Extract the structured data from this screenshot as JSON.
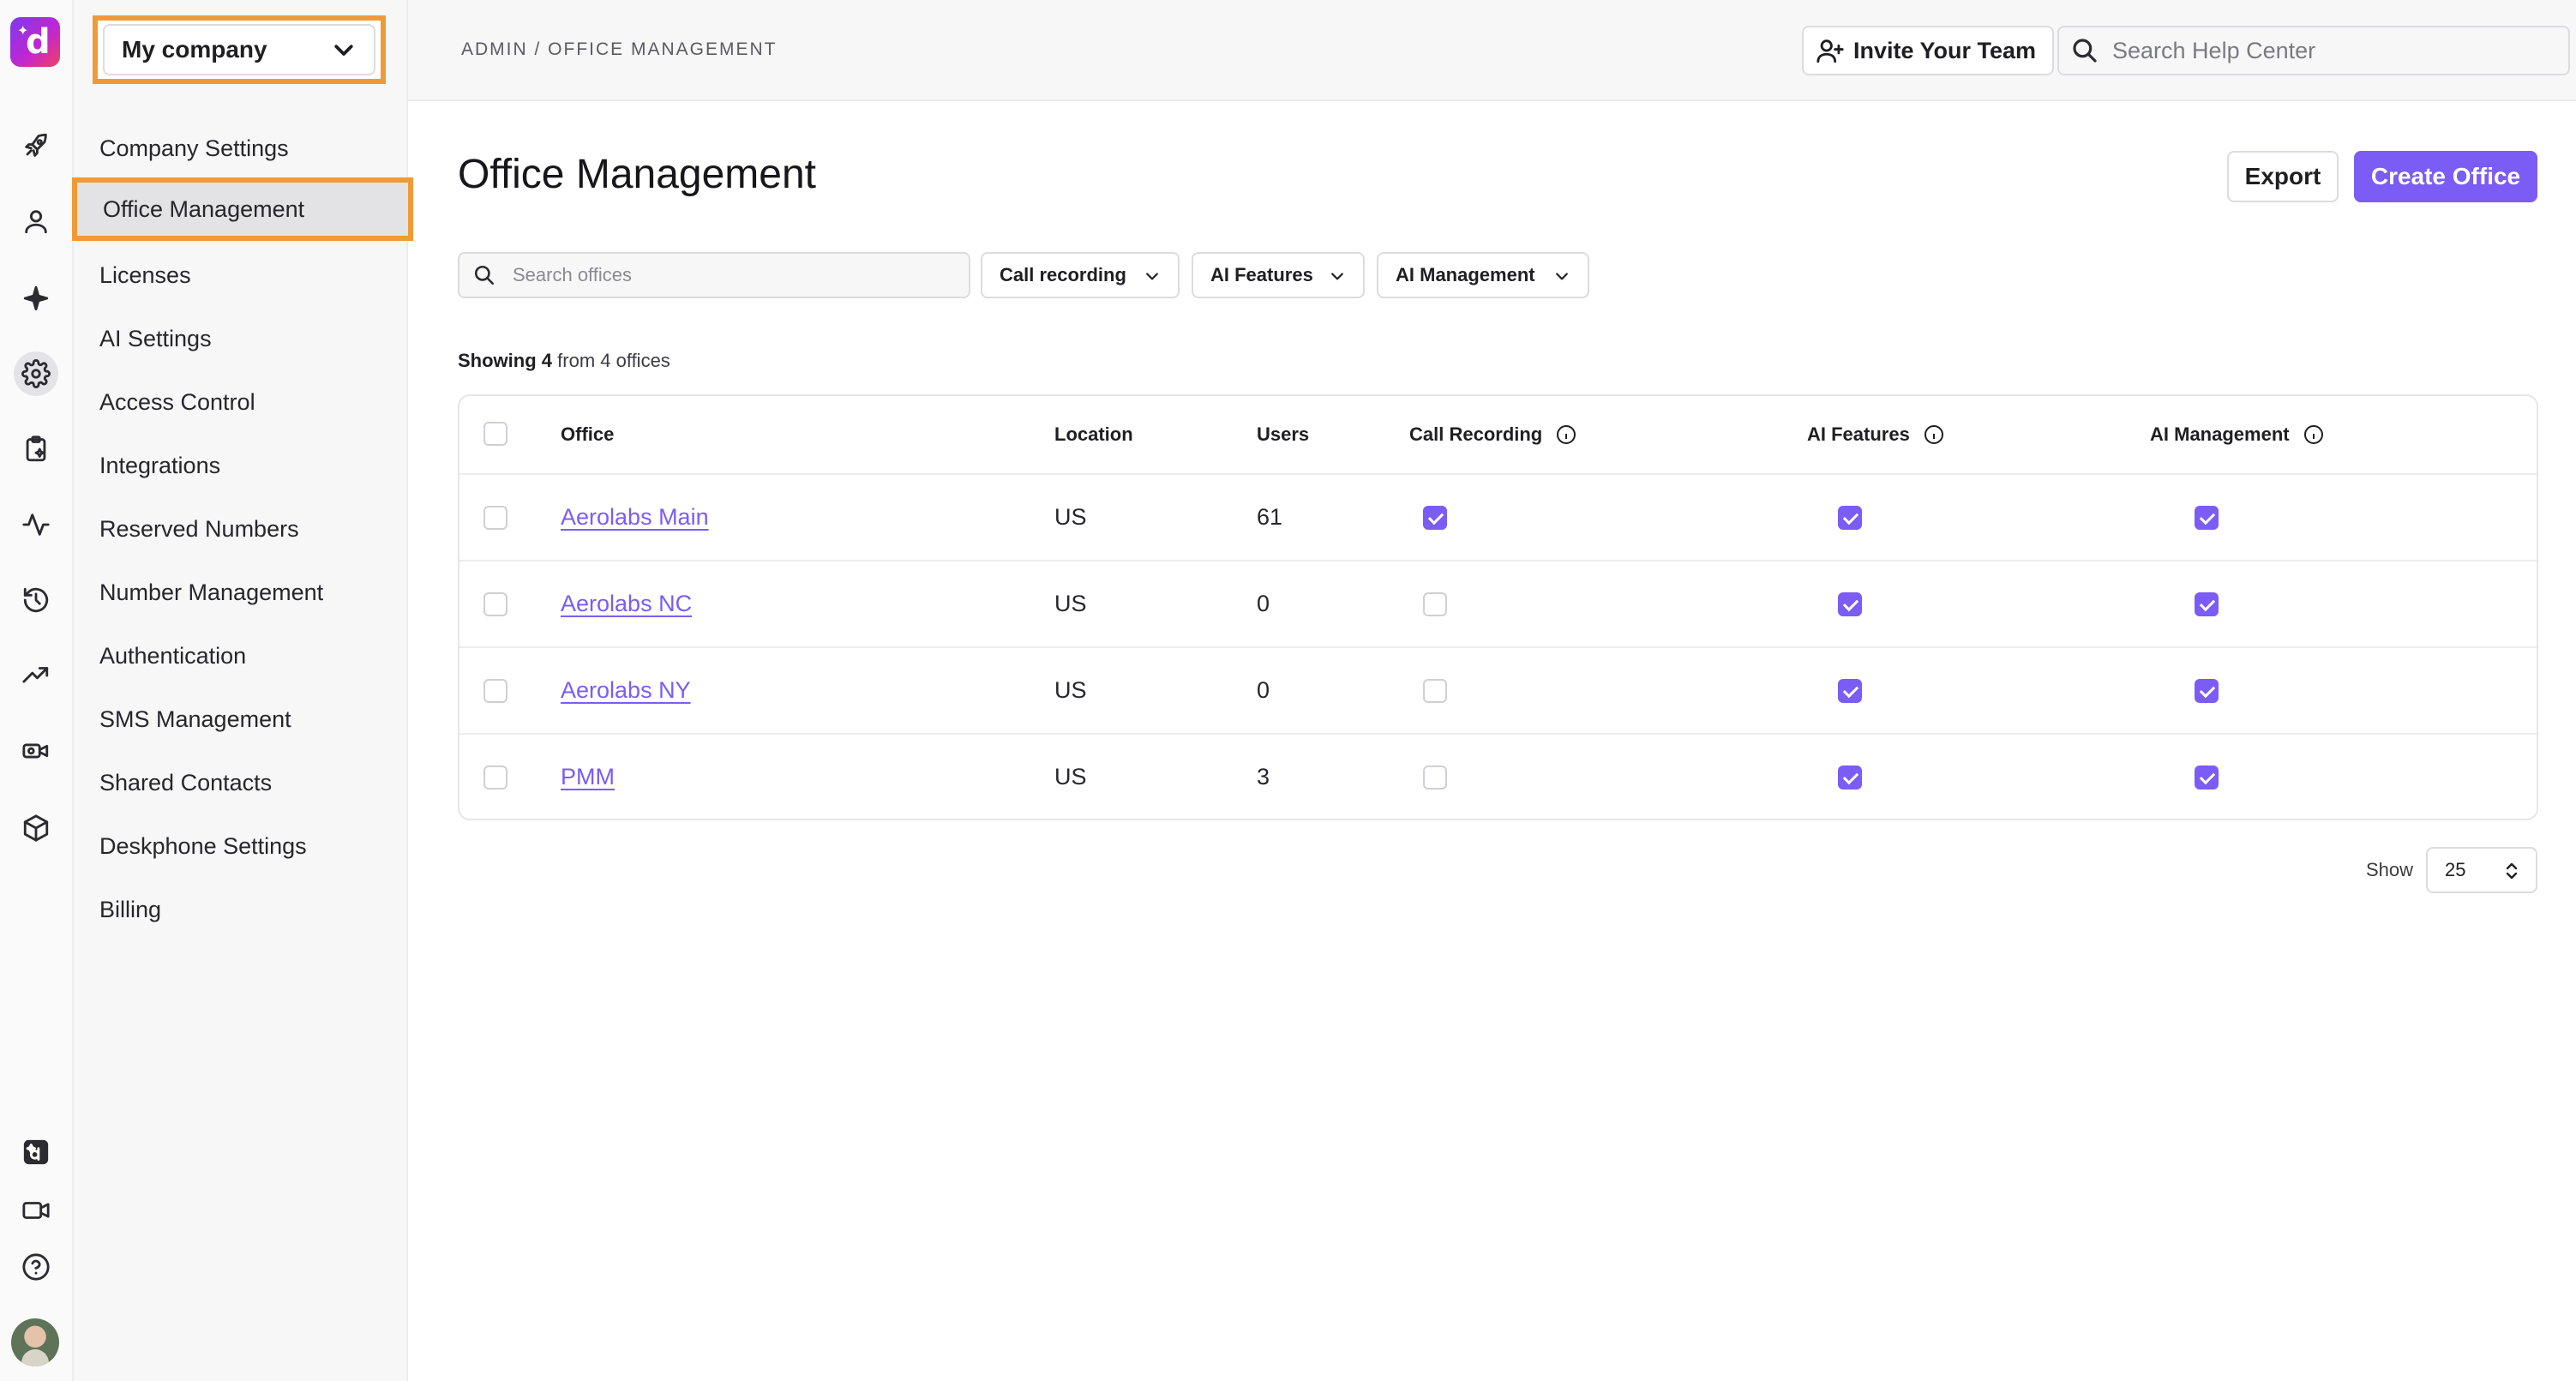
{
  "app": {
    "logo_letter": "d",
    "rail_icons": [
      "rocket-icon",
      "user-icon",
      "sparkle-icon",
      "gear-icon",
      "clipboard-icon",
      "activity-icon",
      "history-icon",
      "trending-icon",
      "video-ai-icon",
      "box-icon",
      "dialpad-ai-icon",
      "video-icon",
      "help-icon"
    ],
    "accent_color": "#7b5cf5",
    "highlight_color": "#f09a37"
  },
  "company_select": {
    "value": "My company"
  },
  "sidebar": {
    "items": [
      {
        "label": "Company Settings"
      },
      {
        "label": "Office Management"
      },
      {
        "label": "Licenses"
      },
      {
        "label": "AI Settings"
      },
      {
        "label": "Access Control"
      },
      {
        "label": "Integrations"
      },
      {
        "label": "Reserved Numbers"
      },
      {
        "label": "Number Management"
      },
      {
        "label": "Authentication"
      },
      {
        "label": "SMS Management"
      },
      {
        "label": "Shared Contacts"
      },
      {
        "label": "Deskphone Settings"
      },
      {
        "label": "Billing"
      }
    ],
    "active": "Office Management"
  },
  "header": {
    "breadcrumb": "ADMIN / OFFICE MANAGEMENT",
    "invite_label": "Invite Your Team",
    "help_search_placeholder": "Search Help Center"
  },
  "main": {
    "title": "Office Management",
    "export_label": "Export",
    "create_label": "Create Office",
    "search_placeholder": "Search offices",
    "filters": [
      "Call recording",
      "AI Features",
      "AI Management"
    ],
    "showing": {
      "prefix": "Showing",
      "count": "4",
      "suffix": "from 4 offices"
    }
  },
  "table": {
    "columns": [
      "Office",
      "Location",
      "Users",
      "Call Recording",
      "AI Features",
      "AI Management"
    ],
    "rows": [
      {
        "office": "Aerolabs Main",
        "location": "US",
        "users": "61",
        "call_recording": true,
        "ai_features": true,
        "ai_management": true
      },
      {
        "office": "Aerolabs NC",
        "location": "US",
        "users": "0",
        "call_recording": false,
        "ai_features": true,
        "ai_management": true
      },
      {
        "office": "Aerolabs NY",
        "location": "US",
        "users": "0",
        "call_recording": false,
        "ai_features": true,
        "ai_management": true
      },
      {
        "office": "PMM",
        "location": "US",
        "users": "3",
        "call_recording": false,
        "ai_features": true,
        "ai_management": true
      }
    ]
  },
  "pagination": {
    "show_label": "Show",
    "page_size": "25"
  }
}
